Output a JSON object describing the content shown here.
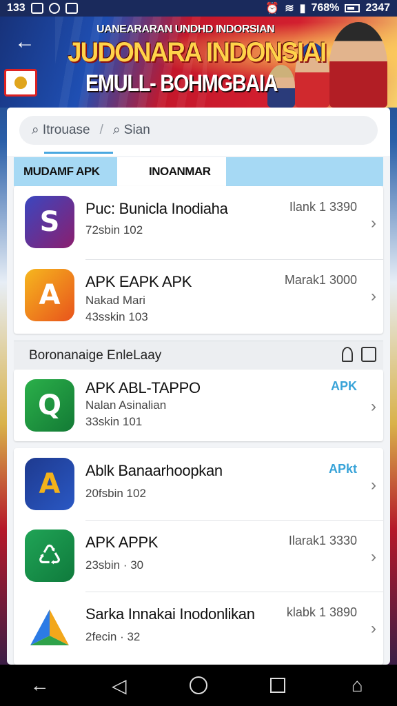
{
  "status_bar": {
    "time_left": "133",
    "battery": "768%",
    "time_right": "2347"
  },
  "banner": {
    "subtitle": "UANEARARAN UNDHD INDORSIAN",
    "title": "JUDONARA INDONSIAI",
    "line2": "EMULL- BOHMGBAIA"
  },
  "search": {
    "breadcrumb": "Itrouase",
    "placeholder": "Sian"
  },
  "tabs": [
    {
      "label": "MUDAMF APK"
    },
    {
      "label": "INOANMAR"
    }
  ],
  "section": {
    "title": "Boronanaige  EnleLaay"
  },
  "apps": [
    {
      "name": "Puc: Bunicla Inodiaha",
      "sub1": "72sbin 102",
      "sub2": "",
      "meta": "Ilank 1 3390",
      "icon": "s-logo-icon",
      "color": "#3b3fa3"
    },
    {
      "name": "APK EAPK APK",
      "sub1": "Nakad Mari",
      "sub2": "43sskin 103",
      "meta": "Marak1 3000",
      "icon": "a-logo-icon",
      "color": "#f29a1f"
    },
    {
      "name": "APK ABL-TAPPO",
      "sub1": "Nalan Asinalian",
      "sub2": "33skin 101",
      "meta": "APK",
      "icon": "q-logo-icon",
      "color": "#1f9a3e"
    },
    {
      "name": "Ablk Banaarhoopkan",
      "sub1": "20fsbin 102",
      "sub2": "",
      "meta": "APkt",
      "icon": "a-play-logo-icon",
      "color": "#2747a0"
    },
    {
      "name": "APK APPK",
      "sub1": "23sbin · 30",
      "sub2": "",
      "meta": "Ilarak1 3330",
      "icon": "recycle-logo-icon",
      "color": "#17914a"
    },
    {
      "name": "Sarka Innakai Inodonlikan",
      "sub1": "2fecin · 32",
      "sub2": "",
      "meta": "klabk 1 3890",
      "icon": "triangle-logo-icon",
      "color": "#1e2030"
    }
  ]
}
